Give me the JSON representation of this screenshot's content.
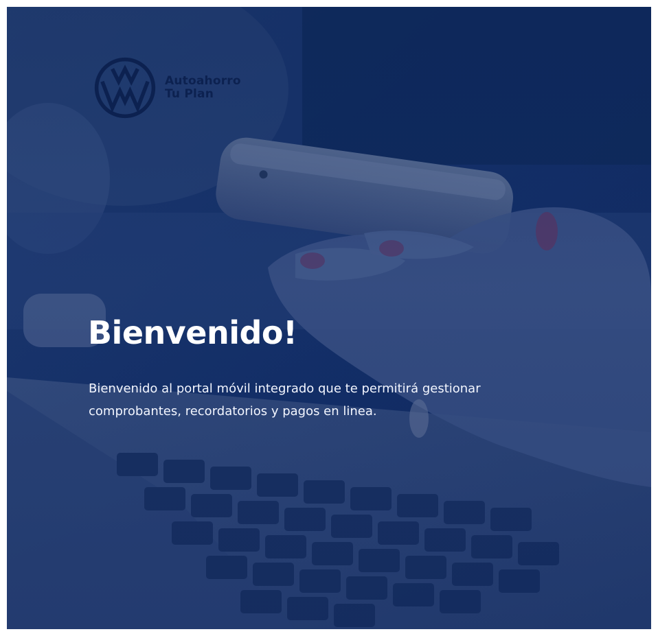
{
  "brand": {
    "logo": "vw-logo-icon",
    "line1": "Autoahorro",
    "line2": "Tu Plan"
  },
  "hero": {
    "title": "Bienvenido!",
    "description": "Bienvenido al portal móvil integrado que te permitirá gestionar comprobantes, recordatorios y pagos en linea."
  },
  "colors": {
    "overlay": "#0f2b60",
    "text": "#ffffff",
    "brand_text": "#0c2150"
  }
}
